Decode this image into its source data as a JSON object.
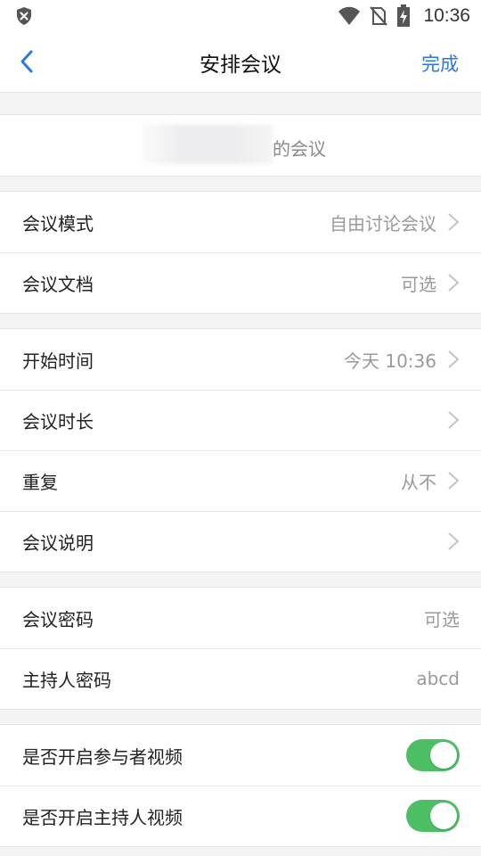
{
  "status_bar": {
    "time": "10:36",
    "icons": [
      "shield-x-icon",
      "wifi-icon",
      "no-sim-icon",
      "battery-charging-icon"
    ]
  },
  "header": {
    "title": "安排会议",
    "done_label": "完成",
    "back_icon": "chevron-left-icon"
  },
  "topic": {
    "suffix": "的会议"
  },
  "section1": {
    "items": [
      {
        "label": "会议模式",
        "value": "自由讨论会议"
      },
      {
        "label": "会议文档",
        "value": "可选"
      }
    ]
  },
  "section2": {
    "items": [
      {
        "label": "开始时间",
        "value": "今天 10:36"
      },
      {
        "label": "会议时长",
        "value": ""
      },
      {
        "label": "重复",
        "value": "从不"
      },
      {
        "label": "会议说明",
        "value": ""
      }
    ]
  },
  "section3": {
    "items": [
      {
        "label": "会议密码",
        "value": "可选"
      },
      {
        "label": "主持人密码",
        "value": "abcd"
      }
    ]
  },
  "section4": {
    "items": [
      {
        "label": "是否开启参与者视频",
        "enabled": true
      },
      {
        "label": "是否开启主持人视频",
        "enabled": true
      }
    ]
  },
  "colors": {
    "accent": "#2b78e4",
    "toggle_on": "#4cbf65",
    "background": "#f4f4f5"
  }
}
